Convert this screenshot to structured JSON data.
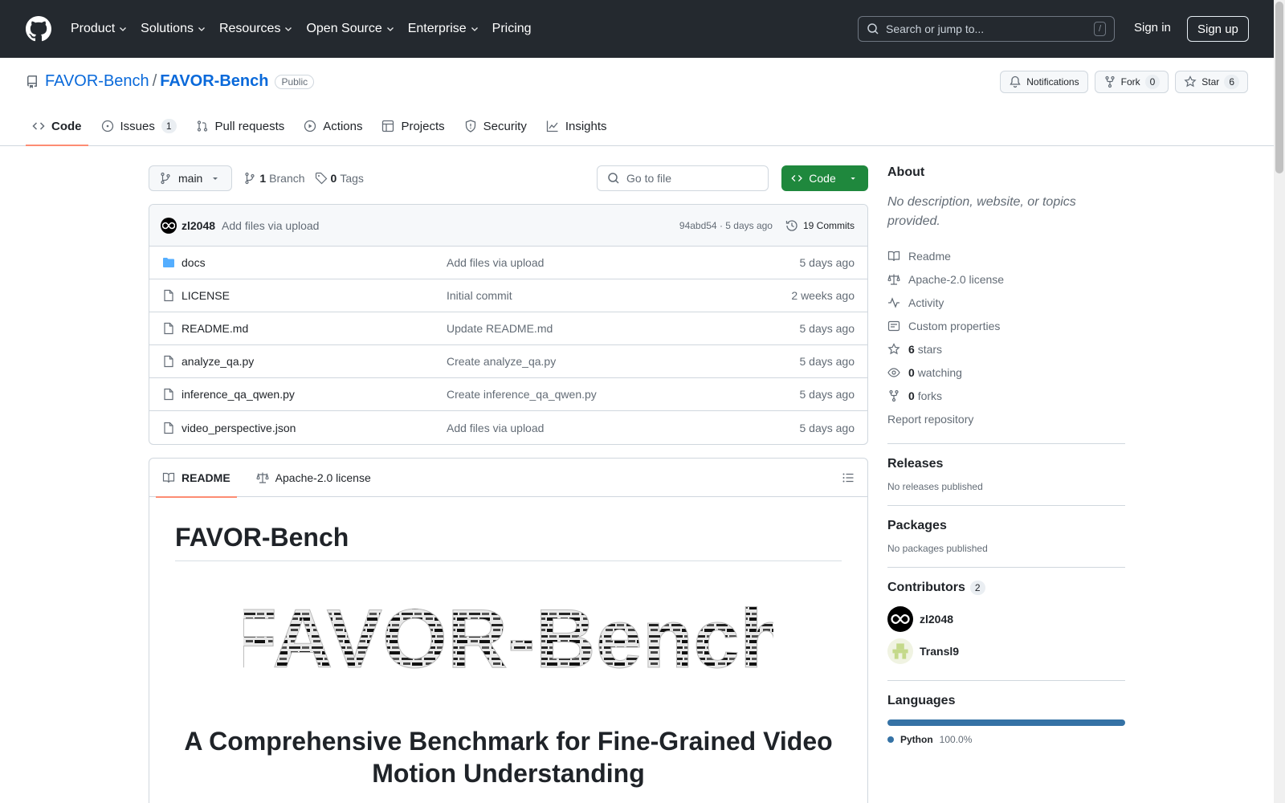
{
  "header": {
    "nav": [
      "Product",
      "Solutions",
      "Resources",
      "Open Source",
      "Enterprise",
      "Pricing"
    ],
    "search_placeholder": "Search or jump to...",
    "search_shortcut": "/",
    "signin": "Sign in",
    "signup": "Sign up"
  },
  "repo": {
    "owner": "FAVOR-Bench",
    "separator": "/",
    "name": "FAVOR-Bench",
    "visibility": "Public",
    "notifications": "Notifications",
    "fork_label": "Fork",
    "fork_count": "0",
    "star_label": "Star",
    "star_count": "6"
  },
  "tabs": [
    {
      "label": "Code",
      "icon": "code-icon"
    },
    {
      "label": "Issues",
      "icon": "issue-icon",
      "count": "1"
    },
    {
      "label": "Pull requests",
      "icon": "pull-request-icon"
    },
    {
      "label": "Actions",
      "icon": "play-icon"
    },
    {
      "label": "Projects",
      "icon": "table-icon"
    },
    {
      "label": "Security",
      "icon": "shield-icon"
    },
    {
      "label": "Insights",
      "icon": "graph-icon"
    }
  ],
  "branch": {
    "name": "main",
    "branch_count": "1",
    "branch_label": "Branch",
    "tag_count": "0",
    "tag_label": "Tags",
    "goto_placeholder": "Go to file",
    "code_button": "Code"
  },
  "commit": {
    "author": "zl2048",
    "message": "Add files via upload",
    "hash_time": "94abd54 · 5 days ago",
    "commits": "19 Commits"
  },
  "files": [
    {
      "name": "docs",
      "type": "folder",
      "message": "Add files via upload",
      "date": "5 days ago"
    },
    {
      "name": "LICENSE",
      "type": "file",
      "message": "Initial commit",
      "date": "2 weeks ago"
    },
    {
      "name": "README.md",
      "type": "file",
      "message": "Update README.md",
      "date": "5 days ago"
    },
    {
      "name": "analyze_qa.py",
      "type": "file",
      "message": "Create analyze_qa.py",
      "date": "5 days ago"
    },
    {
      "name": "inference_qa_qwen.py",
      "type": "file",
      "message": "Create inference_qa_qwen.py",
      "date": "5 days ago"
    },
    {
      "name": "video_perspective.json",
      "type": "file",
      "message": "Add files via upload",
      "date": "5 days ago"
    }
  ],
  "readme": {
    "tab_readme": "README",
    "tab_license": "Apache-2.0 license",
    "h1": "FAVOR-Bench",
    "wordcloud_text": "FAVOR-Bench",
    "h2": "A Comprehensive Benchmark for Fine-Grained Video Motion Understanding"
  },
  "about": {
    "title": "About",
    "description": "No description, website, or topics provided.",
    "links": [
      {
        "icon": "book-icon",
        "label": "Readme"
      },
      {
        "icon": "law-icon",
        "label": "Apache-2.0 license"
      },
      {
        "icon": "pulse-icon",
        "label": "Activity"
      },
      {
        "icon": "note-icon",
        "label": "Custom properties"
      }
    ],
    "stars_count": "6",
    "stars_label": "stars",
    "watching_count": "0",
    "watching_label": "watching",
    "forks_count": "0",
    "forks_label": "forks",
    "report": "Report repository"
  },
  "releases": {
    "title": "Releases",
    "empty": "No releases published"
  },
  "packages": {
    "title": "Packages",
    "empty": "No packages published"
  },
  "contributors": {
    "title": "Contributors",
    "count": "2",
    "people": [
      {
        "name": "zl2048"
      },
      {
        "name": "Transl9"
      }
    ]
  },
  "languages": {
    "title": "Languages",
    "items": [
      {
        "name": "Python",
        "percent": "100.0%",
        "share": 100,
        "color": "#3572a5"
      }
    ]
  }
}
